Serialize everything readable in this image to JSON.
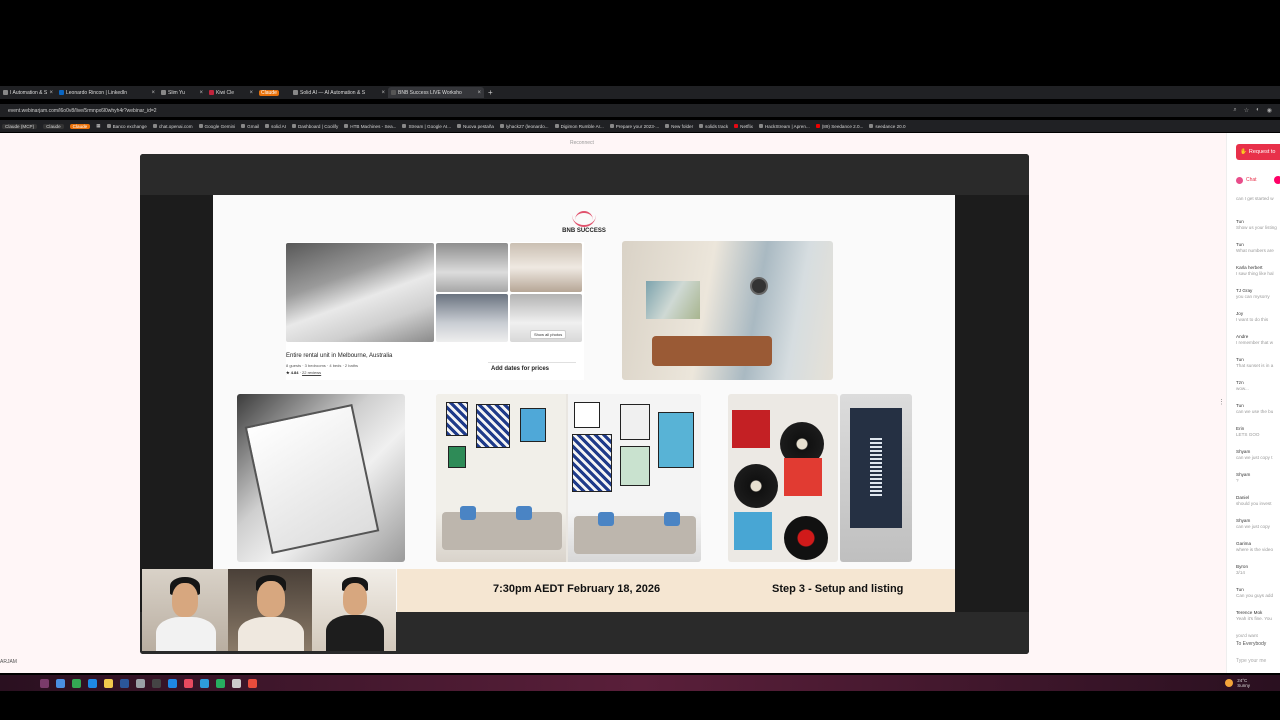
{
  "tabs": [
    {
      "label": "I Automation & S",
      "active": false
    },
    {
      "label": "Leonardo Rincon | LinkedIn",
      "active": false
    },
    {
      "label": "Slim Yu",
      "active": false
    },
    {
      "label": "Kiwi Cle",
      "active": false
    },
    {
      "label": "Claude",
      "active": false,
      "badge": true
    },
    {
      "label": "Solid AI — AI Automation & S",
      "active": false
    },
    {
      "label": "BNB Success LIVE Worksho",
      "active": true
    }
  ],
  "address": {
    "url": "event.webinarjam.com/l6o0v8/live/5rmnpx6l0whyh4r?webinar_id=2"
  },
  "bookmarks": [
    {
      "label": "Claude (MCP)",
      "style": "pill"
    },
    {
      "label": "Claude",
      "style": "pill"
    },
    {
      "label": "Claude",
      "style": "pill-orange"
    },
    {
      "label": "Banco exchange"
    },
    {
      "label": "chat.openai.com"
    },
    {
      "label": "Google Gemini"
    },
    {
      "label": "Gmail"
    },
    {
      "label": "solid AI"
    },
    {
      "label": "Dashboard | Coolify"
    },
    {
      "label": "HTB Machines - Sea..."
    },
    {
      "label": "Stream | Google AI..."
    },
    {
      "label": "Nuova pestaña"
    },
    {
      "label": "lyhack27 (leonardo..."
    },
    {
      "label": "Digimon Rumble Ar..."
    },
    {
      "label": "Prepare your 2023-..."
    },
    {
      "label": "New folder"
    },
    {
      "label": "solids track"
    },
    {
      "label": "Netflix"
    },
    {
      "label": "HackStream | Apren..."
    },
    {
      "label": "(89) Seedance 2.0..."
    },
    {
      "label": "seedance 20.0"
    }
  ],
  "page": {
    "reconnect": "Reconnect",
    "bottom_label": "ARJAM"
  },
  "slide": {
    "logo_text": "BNB SUCCESS",
    "listing": {
      "title": "Entire rental unit in Melbourne, Australia",
      "details": "8 guests · 3 bedrooms · 4 beds · 2 baths",
      "rating": "★ 4.84",
      "reviews": "22 reviews",
      "show_all": "Show all photos",
      "add_dates": "Add dates for prices"
    },
    "date_text": "7:30pm AEDT February 18, 2026",
    "step_text": "Step 3 - Setup and listing"
  },
  "chat": {
    "request_button": "Request to",
    "tab_label": "Chat",
    "messages": [
      {
        "name": "",
        "text": "can I get started w"
      },
      {
        "name": "Tun",
        "text": "Show us your listing"
      },
      {
        "name": "Tun",
        "text": "What numbers are"
      },
      {
        "name": "Karla herbert",
        "text": "I saw thing like hal"
      },
      {
        "name": "TJ Gray",
        "text": "you can mysorry"
      },
      {
        "name": "Joy",
        "text": "I want to do this"
      },
      {
        "name": "Andre",
        "text": "I remember that w"
      },
      {
        "name": "Tun",
        "text": "That sunset is in a"
      },
      {
        "name": "Tzn",
        "text": "wow..."
      },
      {
        "name": "Tun",
        "text": "can we use the bu"
      },
      {
        "name": "Erin",
        "text": "LETS GOO"
      },
      {
        "name": "Shyam",
        "text": "can we just copy t"
      },
      {
        "name": "Shyam",
        "text": "?"
      },
      {
        "name": "Daniel",
        "text": "should you invest"
      },
      {
        "name": "Shyam",
        "text": "can we just copy"
      },
      {
        "name": "Garima",
        "text": "where is the video"
      },
      {
        "name": "Byron",
        "text": "3/14"
      },
      {
        "name": "Tun",
        "text": "Can you guys add"
      },
      {
        "name": "Terence Mok",
        "text": "Yeah it's fine. You"
      },
      {
        "name": "",
        "text": "you'd want"
      }
    ],
    "to_label": "To Everybody",
    "input_placeholder": "Type your me"
  },
  "taskbar": {
    "weather_temp": "24°C",
    "weather_place": "Sunny",
    "icons": [
      "explorer-icon",
      "store-icon",
      "chrome-icon",
      "edge-icon",
      "files-icon",
      "word-icon",
      "settings-icon",
      "terminal-icon",
      "app-icon",
      "app2-icon",
      "app3-icon",
      "app4-icon",
      "app5-icon",
      "app6-icon"
    ]
  },
  "colors": {
    "accent": "#e8304a",
    "tab_orange": "#e8710a",
    "slide_footer": "#f5e6d2"
  }
}
